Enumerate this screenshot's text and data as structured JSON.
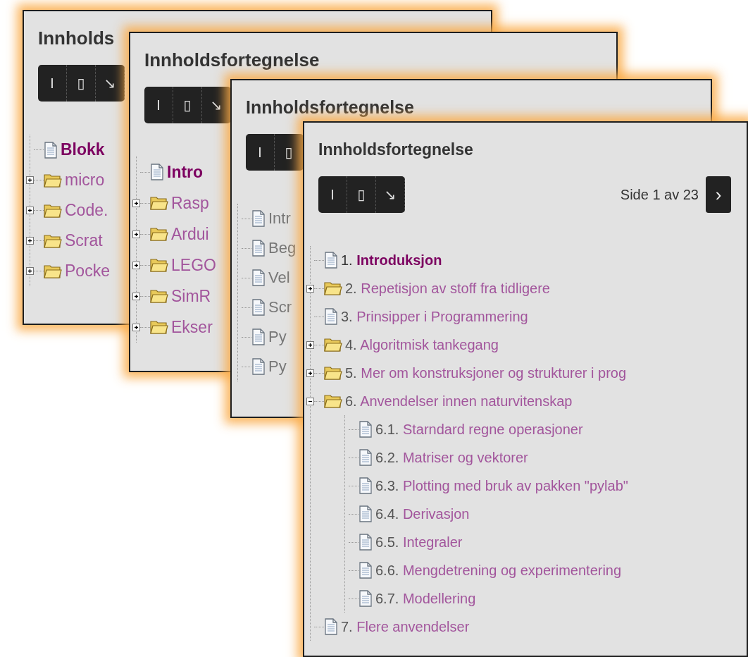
{
  "panels": [
    {
      "title": "Innholds",
      "toolbar": [
        "I",
        "▯",
        "↘"
      ],
      "items": [
        {
          "kind": "page",
          "title": "Blokk",
          "selected": true
        },
        {
          "kind": "folder",
          "title": "micro",
          "expanded": false,
          "selected": false
        },
        {
          "kind": "folder",
          "title": "Code.",
          "expanded": false,
          "selected": false
        },
        {
          "kind": "folder",
          "title": "Scrat",
          "expanded": false,
          "selected": false
        },
        {
          "kind": "folder",
          "title": "Pocke",
          "expanded": false,
          "selected": false
        }
      ]
    },
    {
      "title": "Innholdsfortegnelse",
      "toolbar": [
        "I",
        "▯",
        "↘"
      ],
      "items": [
        {
          "kind": "page",
          "title": "Intro",
          "selected": true
        },
        {
          "kind": "folder",
          "title": "Rasp",
          "expanded": false,
          "selected": false
        },
        {
          "kind": "folder",
          "title": "Ardui",
          "expanded": false,
          "selected": false
        },
        {
          "kind": "folder",
          "title": "LEGO",
          "expanded": false,
          "selected": false
        },
        {
          "kind": "folder",
          "title": "SimR",
          "expanded": false,
          "selected": false
        },
        {
          "kind": "folder",
          "title": "Ekser",
          "expanded": false,
          "selected": false
        }
      ]
    },
    {
      "title": "Innholdsfortegnelse",
      "toolbar": [
        "I",
        "▯"
      ],
      "items": [
        {
          "kind": "page",
          "title": "Intr",
          "selected": false,
          "disabled": true
        },
        {
          "kind": "page",
          "title": "Beg",
          "selected": false,
          "disabled": true
        },
        {
          "kind": "page",
          "title": "Vel",
          "selected": false,
          "disabled": true
        },
        {
          "kind": "page",
          "title": "Scr",
          "selected": false,
          "disabled": true
        },
        {
          "kind": "page",
          "title": "Py",
          "selected": false,
          "disabled": true
        },
        {
          "kind": "page",
          "title": "Py",
          "selected": false,
          "disabled": true
        }
      ]
    },
    {
      "title": "Innholdsfortegnelse",
      "toolbar": [
        "I",
        "▯",
        "↘"
      ],
      "pager": {
        "text": "Side 1 av 23",
        "next": "›"
      },
      "items": [
        {
          "kind": "page",
          "number": "1.",
          "title": "Introduksjon",
          "selected": true
        },
        {
          "kind": "folder",
          "number": "2.",
          "title": "Repetisjon av stoff fra tidligere",
          "expanded": false,
          "selected": false
        },
        {
          "kind": "page",
          "number": "3.",
          "title": "Prinsipper i Programmering",
          "selected": false
        },
        {
          "kind": "folder",
          "number": "4.",
          "title": "Algoritmisk tankegang",
          "expanded": false,
          "selected": false
        },
        {
          "kind": "folder",
          "number": "5.",
          "title": "Mer om konstruksjoner og strukturer i prog",
          "expanded": false,
          "selected": false
        },
        {
          "kind": "folder",
          "number": "6.",
          "title": "Anvendelser innen naturvitenskap",
          "expanded": true,
          "selected": false,
          "children": [
            {
              "kind": "page",
              "number": "6.1.",
              "title": "Starndard regne operasjoner",
              "selected": false
            },
            {
              "kind": "page",
              "number": "6.2.",
              "title": "Matriser og vektorer",
              "selected": false
            },
            {
              "kind": "page",
              "number": "6.3.",
              "title": "Plotting med bruk av pakken \"pylab\"",
              "selected": false
            },
            {
              "kind": "page",
              "number": "6.4.",
              "title": "Derivasjon",
              "selected": false
            },
            {
              "kind": "page",
              "number": "6.5.",
              "title": "Integraler",
              "selected": false
            },
            {
              "kind": "page",
              "number": "6.6.",
              "title": "Mengdetrening og experimentering",
              "selected": false
            },
            {
              "kind": "page",
              "number": "6.7.",
              "title": "Modellering",
              "selected": false
            }
          ]
        },
        {
          "kind": "page",
          "number": "7.",
          "title": "Flere anvendelser",
          "selected": false
        }
      ]
    }
  ]
}
